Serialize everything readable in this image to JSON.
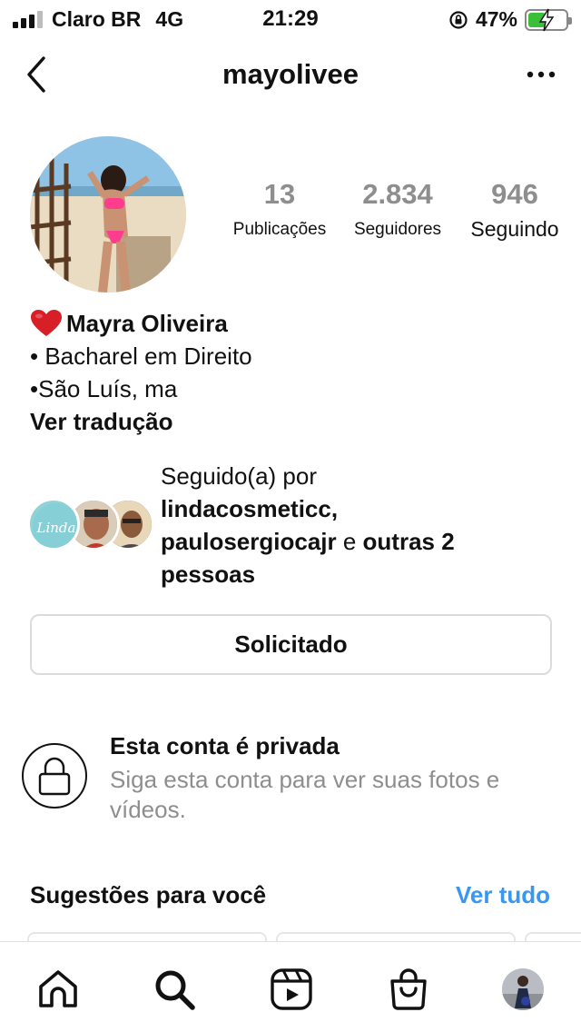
{
  "status_bar": {
    "carrier": "Claro BR",
    "network": "4G",
    "time": "21:29",
    "battery": "47%",
    "battery_level": 0.47,
    "signal_bars_active": 3,
    "icons": [
      "signal-icon",
      "rotation-lock-icon",
      "battery-charging-icon"
    ]
  },
  "header": {
    "username": "mayolivee",
    "icons": [
      "back-chevron-icon",
      "more-options-icon"
    ]
  },
  "stats": [
    {
      "value": "13",
      "label": "Publicações"
    },
    {
      "value": "2.834",
      "label": "Seguidores"
    },
    {
      "value": "946",
      "label": "Seguindo"
    }
  ],
  "bio": {
    "name": "Mayra Oliveira",
    "name_emoji": "heart-icon",
    "line1": "• Bacharel em Direito",
    "line2": "•São Luís, ma",
    "translate": "Ver tradução"
  },
  "followed_by": {
    "prefix": "Seguido(a) por",
    "user1": "lindacosmeticc,",
    "user2": "paulosergiocajr",
    "connector": " e ",
    "others": "outras 2",
    "suffix": "pessoas",
    "avatar_logo_text": "Linda"
  },
  "request_button": {
    "label": "Solicitado"
  },
  "private_account": {
    "title": "Esta conta é privada",
    "subtitle": "Siga esta conta para ver suas fotos e vídeos."
  },
  "suggestions": {
    "title": "Sugestões para você",
    "see_all": "Ver tudo"
  },
  "tabbar": {
    "items": [
      "home-icon",
      "search-icon",
      "reels-icon",
      "shop-icon",
      "profile-avatar"
    ]
  },
  "colors": {
    "link_blue": "#3897f0",
    "muted_gray": "#8e8e8e",
    "heart_red": "#d61f26",
    "battery_green": "#3bbf3b"
  }
}
